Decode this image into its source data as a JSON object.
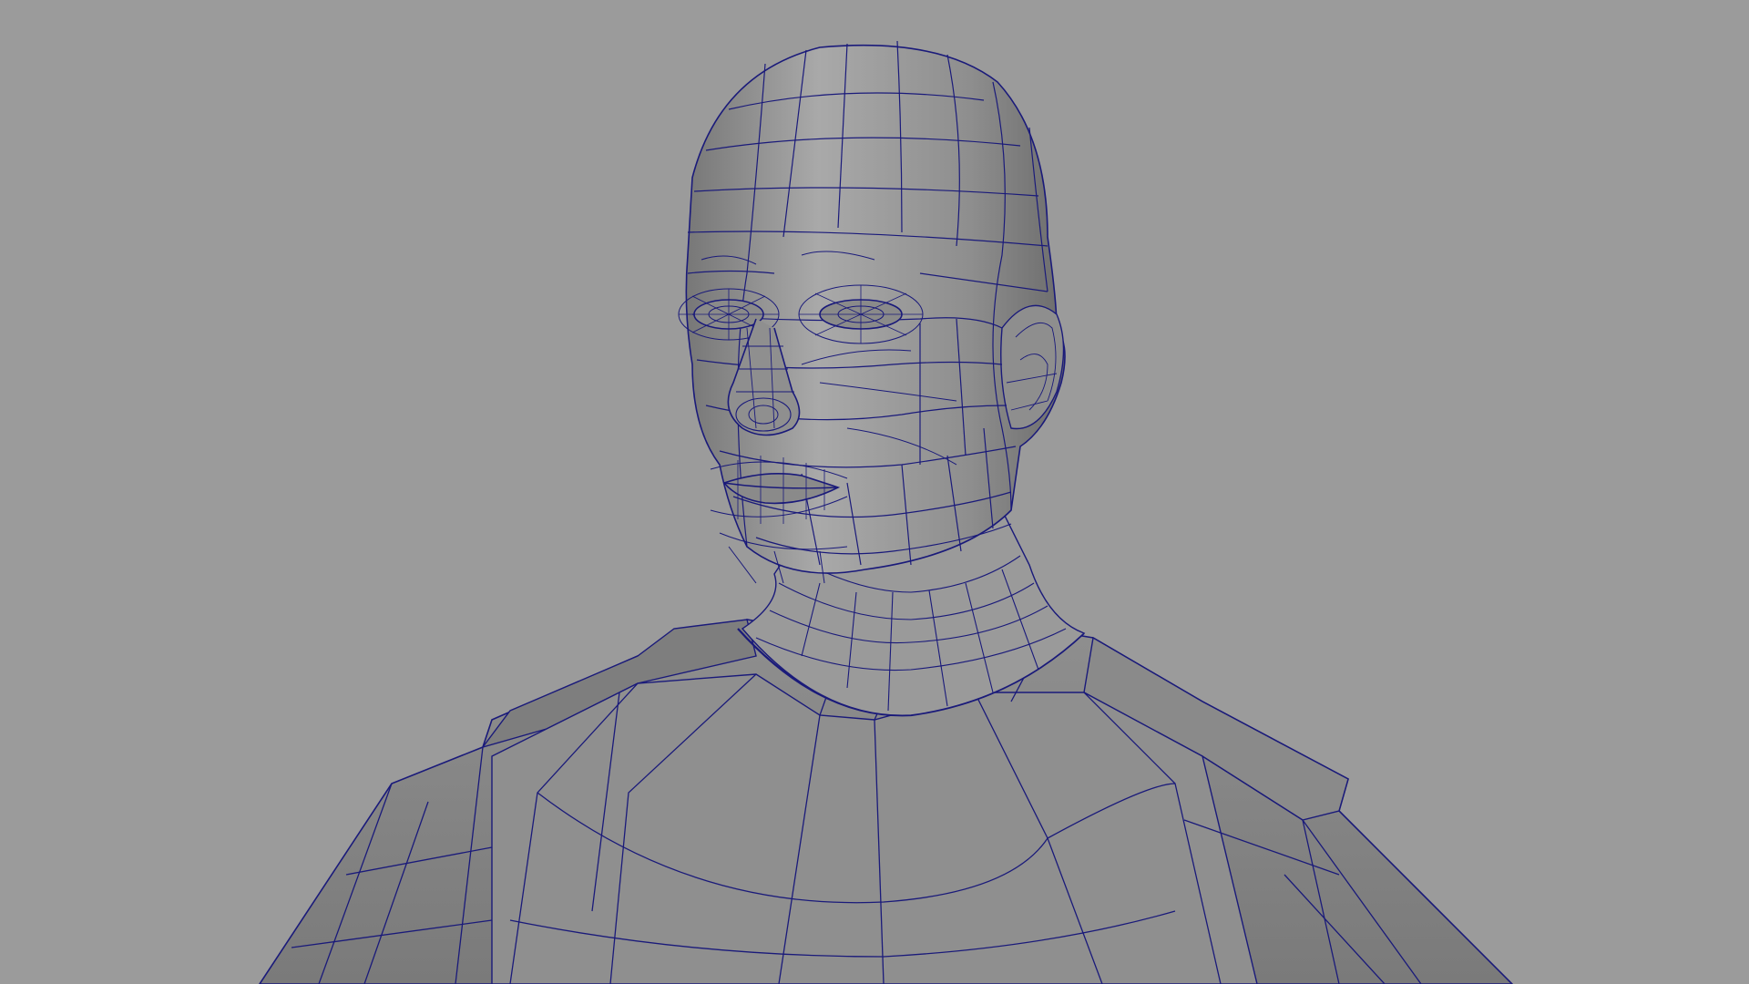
{
  "viewport": {
    "background_color": "#9b9b9b",
    "surface_light": "#a6a6a6",
    "surface_mid": "#8c8c8c",
    "surface_dark": "#6e6e6e",
    "wire_color": "#1a1a7a"
  },
  "model": {
    "display_mode": "wireframe-on-shaded"
  }
}
